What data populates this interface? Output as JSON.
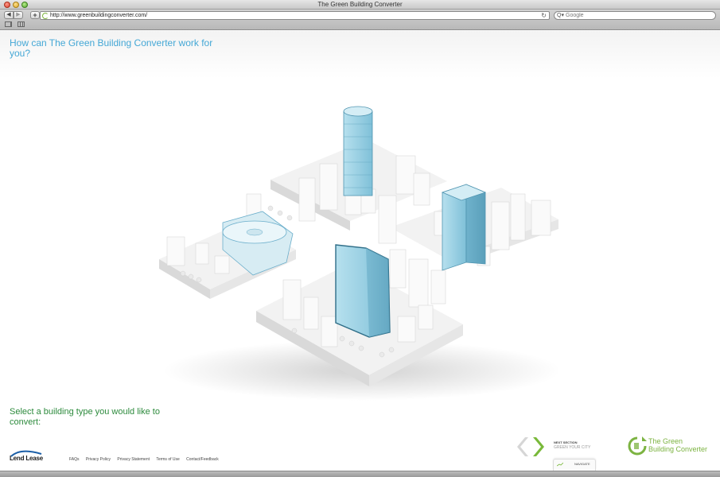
{
  "window": {
    "title": "The Green Building Converter"
  },
  "toolbar": {
    "back_label": "◀",
    "forward_label": "▶",
    "add_label": "+",
    "url": "http://www.greenbuildingconverter.com/",
    "search_placeholder": "Google"
  },
  "page": {
    "headline": "How can The Green Building Converter work for you?",
    "select_prompt": "Select a building type you would like to convert:",
    "brand_lendlease": "Lend Lease",
    "footer_links": [
      "FAQs",
      "Privacy Policy",
      "Privacy Statement",
      "Terms of Use",
      "Contact/Feedback"
    ],
    "next_section_label": "NEXT SECTION",
    "next_section_title": "GREEN YOUR CITY",
    "navigate_label": "NAVIGATE",
    "logo_text_line1": "The Green",
    "logo_text_line2": "Building Converter"
  },
  "colors": {
    "headline_blue": "#45a8d6",
    "prompt_green": "#2c8a3c",
    "arrow_green": "#79b93a",
    "arrow_grey": "#d6d6d6",
    "building_highlight": "#8ccbe0"
  }
}
